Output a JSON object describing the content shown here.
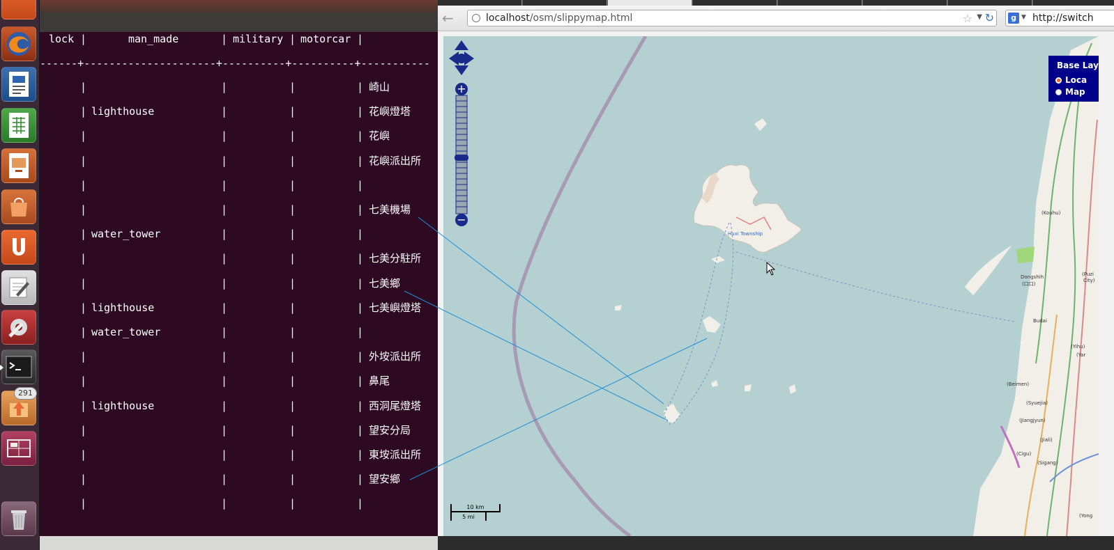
{
  "launcher": {
    "apps": [
      {
        "name": "dash"
      },
      {
        "name": "firefox"
      },
      {
        "name": "libreoffice-writer"
      },
      {
        "name": "libreoffice-calc"
      },
      {
        "name": "libreoffice-impress"
      },
      {
        "name": "ubuntu-software-center"
      },
      {
        "name": "ubuntu-one"
      },
      {
        "name": "text-editor"
      },
      {
        "name": "system-settings"
      },
      {
        "name": "terminal"
      },
      {
        "name": "update-manager",
        "badge": "291"
      },
      {
        "name": "workspace-switcher"
      },
      {
        "name": "trash"
      }
    ]
  },
  "terminal": {
    "header": {
      "c0": "lock",
      "c1": "man_made",
      "c2": "military",
      "c3": "motorcar"
    },
    "separator": "------+---------------------+----------+----------+-----------",
    "rows": [
      {
        "man_made": "",
        "name": "崎山"
      },
      {
        "man_made": "lighthouse",
        "name": "花嶼燈塔"
      },
      {
        "man_made": "",
        "name": "花嶼"
      },
      {
        "man_made": "",
        "name": "花嶼派出所"
      },
      {
        "man_made": "",
        "name": ""
      },
      {
        "man_made": "",
        "name": "七美機場"
      },
      {
        "man_made": "water_tower",
        "name": ""
      },
      {
        "man_made": "",
        "name": "七美分駐所"
      },
      {
        "man_made": "",
        "name": "七美鄉"
      },
      {
        "man_made": "lighthouse",
        "name": "七美嶼燈塔"
      },
      {
        "man_made": "water_tower",
        "name": ""
      },
      {
        "man_made": "",
        "name": "外垵派出所"
      },
      {
        "man_made": "",
        "name": "鼻尾"
      },
      {
        "man_made": "lighthouse",
        "name": "西洞尾燈塔"
      },
      {
        "man_made": "",
        "name": "望安分局"
      },
      {
        "man_made": "",
        "name": "東垵派出所"
      },
      {
        "man_made": "",
        "name": "望安鄉"
      },
      {
        "man_made": "",
        "name": ""
      }
    ]
  },
  "browser": {
    "url_host": "localhost",
    "url_path": "/osm/slippymap.html",
    "search_text": "http://switch",
    "search_engine_icon": "g-icon"
  },
  "map": {
    "layer_switcher": {
      "title": "Base Lay",
      "options": [
        {
          "label": "Loca",
          "selected": true
        },
        {
          "label": "Map",
          "selected": false
        }
      ]
    },
    "scale": {
      "km": "10 km",
      "mi": "5 mi"
    },
    "labels": {
      "huxi": "Huxi Township",
      "kouhu": "(Kouhu)",
      "dongshih": "Dongshih",
      "dongshih2": "(口口)",
      "puzi": "(Puzi",
      "city": "City)",
      "budai": "Budai",
      "yihu": "(Yihu)",
      "yar": "(Yar",
      "beimen": "(Beimen)",
      "syuejia": "(Syuejia)",
      "jiangjyun": "(Jiangjyun)",
      "jiali": "(Jiali)",
      "cigu": "(Cigu)",
      "sigang": "(Sigang)",
      "yong": "(Yong"
    },
    "colors": {
      "sea": "#b5d0d0",
      "land": "#f2efe9",
      "highway": "#6bb36b",
      "coast_ring": "#a89ab4"
    }
  }
}
